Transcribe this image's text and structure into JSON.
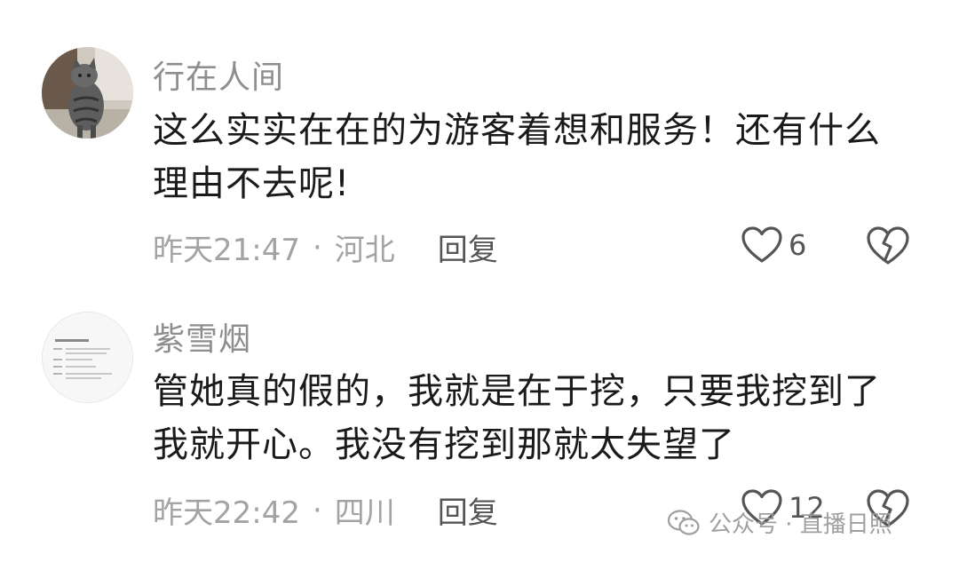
{
  "comments": [
    {
      "username": "行在人间",
      "avatar_icon": "cat-photo-avatar",
      "content_lines": [
        "这么实实在在的为游客着想和服务！还有什么",
        "理由不去呢!"
      ],
      "time": "昨天21:47",
      "separator": "·",
      "location": "河北",
      "reply_label": "回复",
      "likes": "6",
      "like_icon": "heart-outline-icon",
      "dislike_icon": "broken-heart-icon"
    },
    {
      "username": "紫雪烟",
      "avatar_icon": "document-screenshot-avatar",
      "content_lines": [
        "管她真的假的，我就是在于挖，只要我挖到了",
        "我就开心。我没有挖到那就太失望了"
      ],
      "time": "昨天22:42",
      "separator": "·",
      "location": "四川",
      "reply_label": "回复",
      "likes": "12",
      "like_icon": "heart-outline-icon",
      "dislike_icon": "broken-heart-icon"
    }
  ],
  "watermark": {
    "icon": "wechat-icon",
    "text": "公众号 · 直播日照"
  }
}
